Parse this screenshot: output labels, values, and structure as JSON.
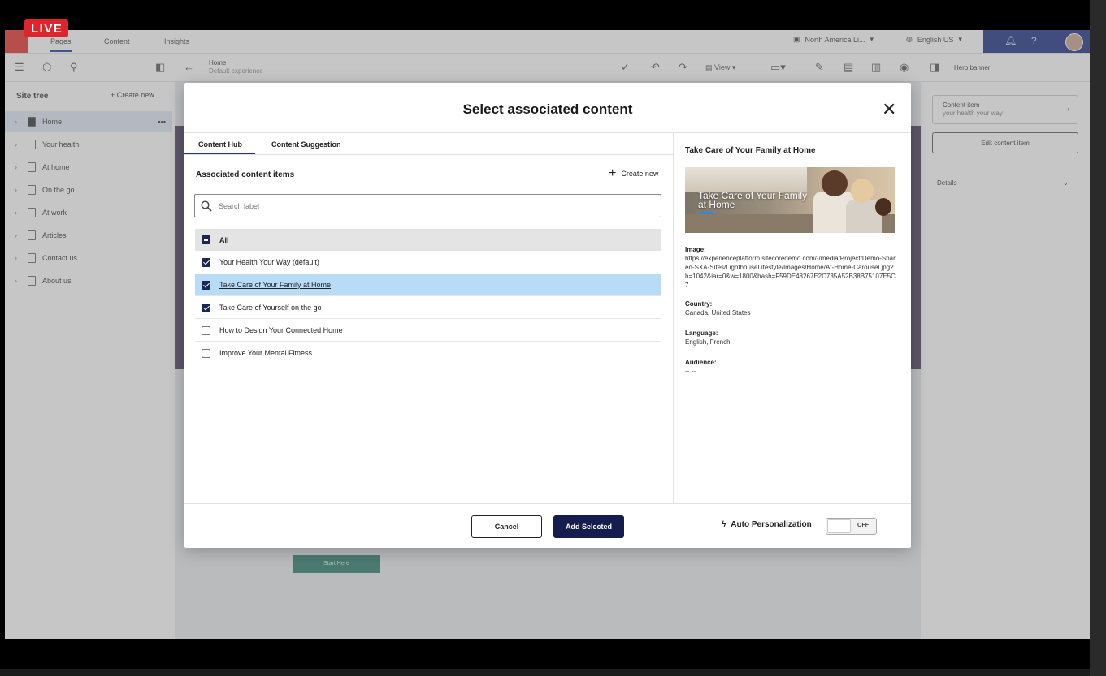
{
  "live_badge": "LIVE",
  "topnav": {
    "tabs": [
      "Pages",
      "Content",
      "Insights"
    ],
    "site": "North America Li...",
    "language": "English US"
  },
  "toolbar": {
    "page": "Home",
    "variant": "Default experience",
    "view_label": "View",
    "component": "Hero banner"
  },
  "sidebar": {
    "title": "Site tree",
    "create_new": "Create new",
    "items": [
      "Home",
      "Your health",
      "At home",
      "On the go",
      "At work",
      "Articles",
      "Contact us",
      "About us"
    ]
  },
  "canvas": {
    "start_button": "Start Here"
  },
  "right_panel": {
    "content_item_label": "Content item",
    "content_item_value": "your health your way",
    "edit_button": "Edit content item",
    "details": "Details"
  },
  "modal": {
    "title": "Select associated content",
    "tabs": [
      "Content Hub",
      "Content Suggestion"
    ],
    "section_title": "Associated content items",
    "create_new": "Create new",
    "search_placeholder": "Search label",
    "all_label": "All",
    "items": [
      {
        "label": "Your Health Your Way (default)",
        "checked": true
      },
      {
        "label": "Take Care of Your Family at Home",
        "checked": true,
        "selected": true
      },
      {
        "label": "Take Care of Yourself on the go",
        "checked": true
      },
      {
        "label": "How to Design Your Connected Home",
        "checked": false
      },
      {
        "label": "Improve Your Mental Fitness",
        "checked": false
      }
    ],
    "preview": {
      "title": "Take Care of Your Family at Home",
      "image_caption": "Take Care of Your Family at Home",
      "image_label": "Image:",
      "image_url": "https://experienceplatform.sitecoredemo.com/-/media/Project/Demo-Shared-SXA-Sites/LighthouseLifestyle/Images/Home/At-Home-Carousel.jpg?h=1042&iar=0&w=1800&hash=F59DE48267E2C735A52B38B75107E5C7",
      "country_label": "Country:",
      "country": "Canada, United States",
      "language_label": "Language:",
      "language": "English, French",
      "audience_label": "Audience:",
      "audience": "-- --"
    },
    "cancel": "Cancel",
    "add_selected": "Add Selected",
    "auto_personalization": "Auto Personalization",
    "toggle_state": "OFF"
  },
  "colors": {
    "brand_navy": "#1b2f84",
    "primary_button": "#141d4d",
    "selected_row": "#b9dcf6",
    "live_red": "#e0242c"
  }
}
